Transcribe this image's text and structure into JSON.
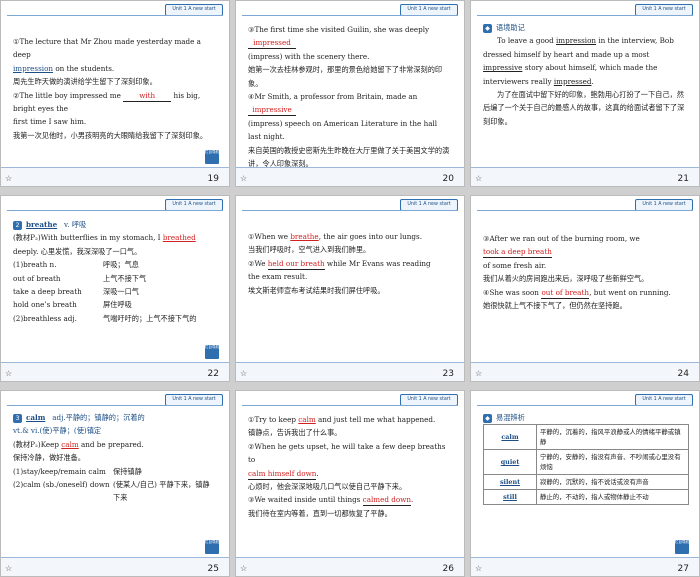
{
  "header_tag": "Unit 1   A new start",
  "back_label": "栏目导航",
  "star_icon": "☆",
  "slides": {
    "s19": {
      "page": "19",
      "l1a": "①The lecture that Mr Zhou made yesterday made a deep",
      "l1b_word": "impression",
      "l1b_rest": " on the students.",
      "l2": "周先生昨天做的演讲给学生留下了深刻印象。",
      "l3a": "②The little boy impressed me",
      "l3_blank": "with",
      "l3b": " his big, bright eyes the",
      "l4": "first time I saw him.",
      "l5": "我第一次见他时，小男孩明亮的大眼睛给我留下了深刻印象。"
    },
    "s20": {
      "page": "20",
      "l1a": "③The first time she visited Guilin, she was deeply",
      "l1_blank": "impressed",
      "l2": "(impress) with the scenery there.",
      "l3": "她第一次去桂林参观时，那里的景色给她留下了非常深刻的印象。",
      "l4a": "④Mr Smith, a professor from Britain, made an",
      "l4_blank": "impressive",
      "l5": "(impress) speech on American Literature in the hall last night.",
      "l6": "来自英国的教授史密斯先生昨晚在大厅里做了关于美国文学的演讲，令人印象深刻。"
    },
    "s21": {
      "page": "21",
      "title": "语境助记",
      "l1a": "To leave a good ",
      "l1_word": "impression",
      "l1b": " in the interview, Bob dressed himself by heart and made up a most ",
      "l1_word2": "impressive",
      "l1c": " story about himself, which made the interviewers really ",
      "l1_word3": "impressed",
      "l1d": ".",
      "l2": "为了在面试中留下好的印象，鲍勃用心打扮了一下自己，然后编了一个关于自己的最感人的故事，这真的给面试者留下了深刻印象。"
    },
    "s22": {
      "page": "22",
      "word": "breathe",
      "pos": "v.",
      "meaning": "呼吸",
      "ex_a": "(教材P₂)With butterflies in my stomach, I ",
      "ex_word": "breathed",
      "ex_b": " deeply. 心里发慌，我深深吸了一口气。",
      "rows": [
        [
          "(1)breath n.",
          "呼吸；气息"
        ],
        [
          "out of breath",
          "上气不接下气"
        ],
        [
          "take a deep breath",
          "深吸一口气"
        ],
        [
          "hold one’s breath",
          "屏住呼吸"
        ],
        [
          "(2)breathless adj.",
          "气喘吁吁的；上气不接下气的"
        ]
      ]
    },
    "s23": {
      "page": "23",
      "l1a": "①When we ",
      "l1_word": "breathe",
      "l1b": ", the air goes into our lungs.",
      "l2": "当我们呼吸时，空气进入到我们肺里。",
      "l3a": "②We",
      "l3_blank": "held our breath",
      "l3b": " while Mr Evans was reading",
      "l4": "the exam result.",
      "l5": "埃文斯老师宣布考试结果时我们屏住呼吸。"
    },
    "s24": {
      "page": "24",
      "l1a": "③After we ran out of the burning room, we",
      "l1_blank": "took a deep breath",
      "l2": "of some fresh air.",
      "l3": "我们从着火的房间跑出来后，深呼吸了些新鲜空气。",
      "l4a": "④She was soon",
      "l4_blank": "out of breath",
      "l4b": ", but went on running.",
      "l5": "她很快就上气不接下气了，但仍然在坚持跑。"
    },
    "s25": {
      "page": "25",
      "word": "calm",
      "pos_cn": "adj.平静的；镇静的；沉着的",
      "verb": "vt.& vi.(使)平静；(使)镇定",
      "ex_a": "(教材P₂)Keep ",
      "ex_word": "calm",
      "ex_b": " and be prepared.",
      "ex_cn": "保持冷静，做好准备。",
      "rows": [
        [
          "(1)stay/keep/remain calm",
          "保持镇静"
        ],
        [
          "(2)calm (sb./oneself) down",
          "(使某人/自己) 平静下来，镇静下来"
        ]
      ]
    },
    "s26": {
      "page": "26",
      "l1a": "①Try to keep ",
      "l1_word": "calm",
      "l1b": " and just tell me what happened.",
      "l2": "镇静点，告诉我出了什么事。",
      "l3": "②When he gets upset, he will take a few deep breaths to",
      "l4_blank": "calm himself down",
      "l4b": ".",
      "l5": "心烦时，他会深深地吸几口气以使自己平静下来。",
      "l6a": "③We waited inside until things",
      "l6_blank": "calmed down",
      "l6b": ".",
      "l7": "我们待在室内等着，直到一切都恢复了平静。"
    },
    "s27": {
      "page": "27",
      "title": "易混辨析",
      "rows": [
        [
          "calm",
          "平静的，沉着的，指风平浪静或人的情绪平静或镇静"
        ],
        [
          "quiet",
          "宁静的，安静的，指没有声音、不吵闹或心里没有烦恼"
        ],
        [
          "silent",
          "寂静的，沉默的，指不说话或没有声音"
        ],
        [
          "still",
          "静止的，不动的，指人或物体静止不动"
        ]
      ]
    }
  }
}
